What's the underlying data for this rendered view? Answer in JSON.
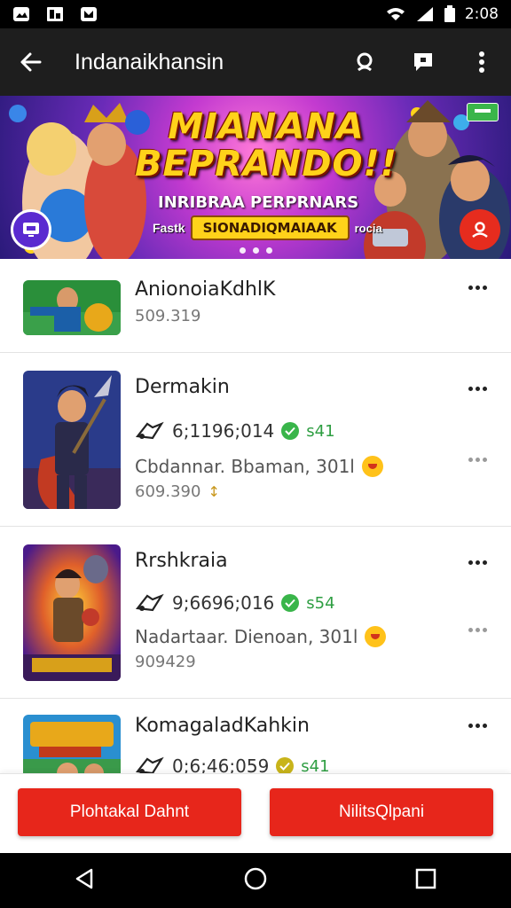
{
  "status_bar": {
    "time": "2:08",
    "left_icons": [
      "image-icon",
      "gallery-icon",
      "video-icon"
    ],
    "right_icons": [
      "wifi-icon",
      "signal-icon",
      "battery-icon"
    ]
  },
  "app_bar": {
    "title": "Indanaikhansin",
    "actions": [
      "search-icon",
      "chat-icon",
      "more-vert-icon"
    ]
  },
  "banner": {
    "headline_line1": "MIANANA",
    "headline_line2": "BEPRANDO!!",
    "subtitle": "INRIBRAA PERPRNARS",
    "strip_prefix": "Fastk",
    "strip_pill": "SIONADIQMAIAAK",
    "strip_suffix": "rocia",
    "dots": 3,
    "active_dot": 0
  },
  "items": [
    {
      "name": "AnionoiaKdhlK",
      "value": "509.319",
      "thumb_colors": [
        "#2a8f3a",
        "#1b5fa8"
      ]
    },
    {
      "name": "Dermakin",
      "stat": "6;1196;014",
      "badge": "s41",
      "meta": "Cbdannar. Bbaman, 301l",
      "value": "609.390",
      "mark": "↕",
      "thumb_colors": [
        "#2a3b8a",
        "#c23a22"
      ]
    },
    {
      "name": "Rrshkraia",
      "stat": "9;6696;016",
      "badge": "s54",
      "meta": "Nadartaar. Dienoan, 301l",
      "value": "909429",
      "thumb_colors": [
        "#6a2ab0",
        "#e08a1a"
      ]
    },
    {
      "name": "KomagaladKahkin",
      "stat": "0;6;46;059",
      "badge": "s41",
      "thumb_colors": [
        "#2a8fd0",
        "#e8a81a"
      ]
    }
  ],
  "buttons": {
    "left": "Plohtakal Dahnt",
    "right": "NilitsQlpani"
  },
  "colors": {
    "accent": "#e7261b",
    "app_bar": "#1e1e1e",
    "green": "#39b54a"
  }
}
